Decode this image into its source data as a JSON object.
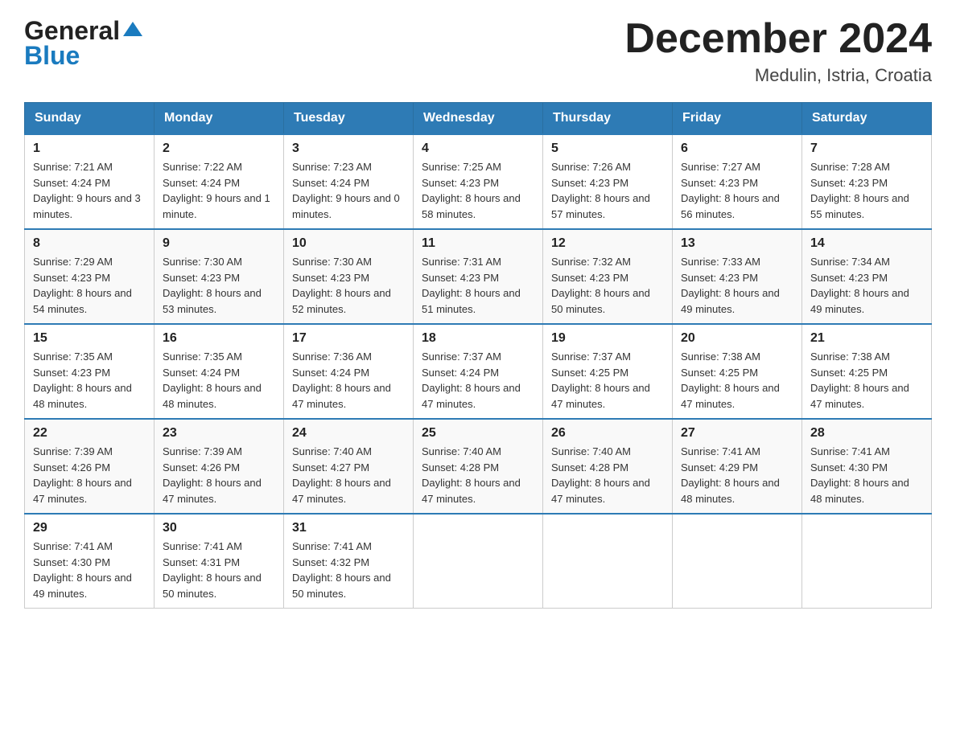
{
  "header": {
    "logo_line1": "General",
    "logo_line2": "Blue",
    "month_title": "December 2024",
    "location": "Medulin, Istria, Croatia"
  },
  "days_of_week": [
    "Sunday",
    "Monday",
    "Tuesday",
    "Wednesday",
    "Thursday",
    "Friday",
    "Saturday"
  ],
  "weeks": [
    [
      {
        "day": "1",
        "sunrise": "7:21 AM",
        "sunset": "4:24 PM",
        "daylight": "9 hours and 3 minutes."
      },
      {
        "day": "2",
        "sunrise": "7:22 AM",
        "sunset": "4:24 PM",
        "daylight": "9 hours and 1 minute."
      },
      {
        "day": "3",
        "sunrise": "7:23 AM",
        "sunset": "4:24 PM",
        "daylight": "9 hours and 0 minutes."
      },
      {
        "day": "4",
        "sunrise": "7:25 AM",
        "sunset": "4:23 PM",
        "daylight": "8 hours and 58 minutes."
      },
      {
        "day": "5",
        "sunrise": "7:26 AM",
        "sunset": "4:23 PM",
        "daylight": "8 hours and 57 minutes."
      },
      {
        "day": "6",
        "sunrise": "7:27 AM",
        "sunset": "4:23 PM",
        "daylight": "8 hours and 56 minutes."
      },
      {
        "day": "7",
        "sunrise": "7:28 AM",
        "sunset": "4:23 PM",
        "daylight": "8 hours and 55 minutes."
      }
    ],
    [
      {
        "day": "8",
        "sunrise": "7:29 AM",
        "sunset": "4:23 PM",
        "daylight": "8 hours and 54 minutes."
      },
      {
        "day": "9",
        "sunrise": "7:30 AM",
        "sunset": "4:23 PM",
        "daylight": "8 hours and 53 minutes."
      },
      {
        "day": "10",
        "sunrise": "7:30 AM",
        "sunset": "4:23 PM",
        "daylight": "8 hours and 52 minutes."
      },
      {
        "day": "11",
        "sunrise": "7:31 AM",
        "sunset": "4:23 PM",
        "daylight": "8 hours and 51 minutes."
      },
      {
        "day": "12",
        "sunrise": "7:32 AM",
        "sunset": "4:23 PM",
        "daylight": "8 hours and 50 minutes."
      },
      {
        "day": "13",
        "sunrise": "7:33 AM",
        "sunset": "4:23 PM",
        "daylight": "8 hours and 49 minutes."
      },
      {
        "day": "14",
        "sunrise": "7:34 AM",
        "sunset": "4:23 PM",
        "daylight": "8 hours and 49 minutes."
      }
    ],
    [
      {
        "day": "15",
        "sunrise": "7:35 AM",
        "sunset": "4:23 PM",
        "daylight": "8 hours and 48 minutes."
      },
      {
        "day": "16",
        "sunrise": "7:35 AM",
        "sunset": "4:24 PM",
        "daylight": "8 hours and 48 minutes."
      },
      {
        "day": "17",
        "sunrise": "7:36 AM",
        "sunset": "4:24 PM",
        "daylight": "8 hours and 47 minutes."
      },
      {
        "day": "18",
        "sunrise": "7:37 AM",
        "sunset": "4:24 PM",
        "daylight": "8 hours and 47 minutes."
      },
      {
        "day": "19",
        "sunrise": "7:37 AM",
        "sunset": "4:25 PM",
        "daylight": "8 hours and 47 minutes."
      },
      {
        "day": "20",
        "sunrise": "7:38 AM",
        "sunset": "4:25 PM",
        "daylight": "8 hours and 47 minutes."
      },
      {
        "day": "21",
        "sunrise": "7:38 AM",
        "sunset": "4:25 PM",
        "daylight": "8 hours and 47 minutes."
      }
    ],
    [
      {
        "day": "22",
        "sunrise": "7:39 AM",
        "sunset": "4:26 PM",
        "daylight": "8 hours and 47 minutes."
      },
      {
        "day": "23",
        "sunrise": "7:39 AM",
        "sunset": "4:26 PM",
        "daylight": "8 hours and 47 minutes."
      },
      {
        "day": "24",
        "sunrise": "7:40 AM",
        "sunset": "4:27 PM",
        "daylight": "8 hours and 47 minutes."
      },
      {
        "day": "25",
        "sunrise": "7:40 AM",
        "sunset": "4:28 PM",
        "daylight": "8 hours and 47 minutes."
      },
      {
        "day": "26",
        "sunrise": "7:40 AM",
        "sunset": "4:28 PM",
        "daylight": "8 hours and 47 minutes."
      },
      {
        "day": "27",
        "sunrise": "7:41 AM",
        "sunset": "4:29 PM",
        "daylight": "8 hours and 48 minutes."
      },
      {
        "day": "28",
        "sunrise": "7:41 AM",
        "sunset": "4:30 PM",
        "daylight": "8 hours and 48 minutes."
      }
    ],
    [
      {
        "day": "29",
        "sunrise": "7:41 AM",
        "sunset": "4:30 PM",
        "daylight": "8 hours and 49 minutes."
      },
      {
        "day": "30",
        "sunrise": "7:41 AM",
        "sunset": "4:31 PM",
        "daylight": "8 hours and 50 minutes."
      },
      {
        "day": "31",
        "sunrise": "7:41 AM",
        "sunset": "4:32 PM",
        "daylight": "8 hours and 50 minutes."
      },
      null,
      null,
      null,
      null
    ]
  ],
  "labels": {
    "sunrise": "Sunrise:",
    "sunset": "Sunset:",
    "daylight": "Daylight:"
  }
}
